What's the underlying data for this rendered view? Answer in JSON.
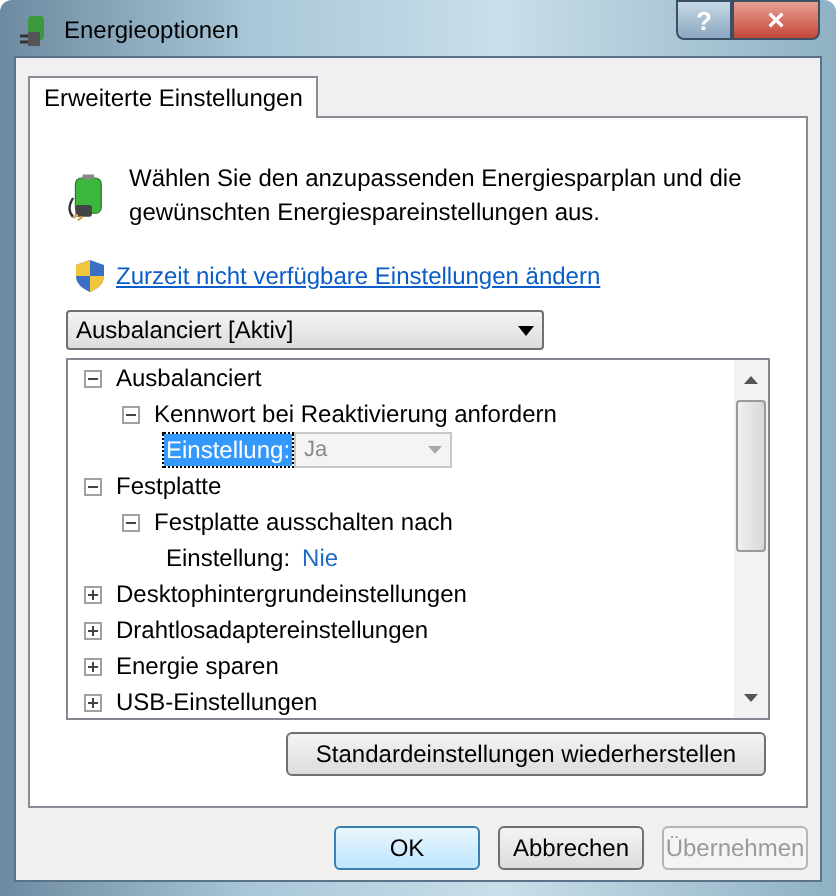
{
  "window": {
    "title": "Energieoptionen",
    "help_button": "?",
    "close_button": "×"
  },
  "tabs": [
    {
      "label": "Erweiterte Einstellungen",
      "selected": true
    }
  ],
  "intro": "Wählen Sie den anzupassenden Energiesparplan und die gewünschten Energiespareinstellungen aus.",
  "admin_link": "Zurzeit nicht verfügbare Einstellungen ändern",
  "plan_select": {
    "value": "Ausbalanciert [Aktiv]"
  },
  "tree": [
    {
      "label": "Ausbalanciert",
      "expanded": true,
      "children": [
        {
          "label": "Kennwort bei Reaktivierung anfordern",
          "expanded": true,
          "children": [
            {
              "kind": "dropdown",
              "label": "Einstellung:",
              "value": "Ja",
              "selected": true,
              "disabled": true
            }
          ]
        }
      ]
    },
    {
      "label": "Festplatte",
      "expanded": true,
      "children": [
        {
          "label": "Festplatte ausschalten nach",
          "expanded": true,
          "children": [
            {
              "kind": "link",
              "label": "Einstellung:",
              "value": "Nie",
              "selected": false
            }
          ]
        }
      ]
    },
    {
      "label": "Desktophintergrundeinstellungen",
      "expanded": false
    },
    {
      "label": "Drahtlosadaptereinstellungen",
      "expanded": false
    },
    {
      "label": "Energie sparen",
      "expanded": false
    },
    {
      "label": "USB-Einstellungen",
      "expanded": false
    }
  ],
  "restore_button": "Standardeinstellungen wiederherstellen",
  "buttons": [
    {
      "label": "OK",
      "default": true,
      "disabled": false
    },
    {
      "label": "Abbrechen",
      "default": false,
      "disabled": false
    },
    {
      "label": "Übernehmen",
      "default": false,
      "disabled": true
    }
  ]
}
